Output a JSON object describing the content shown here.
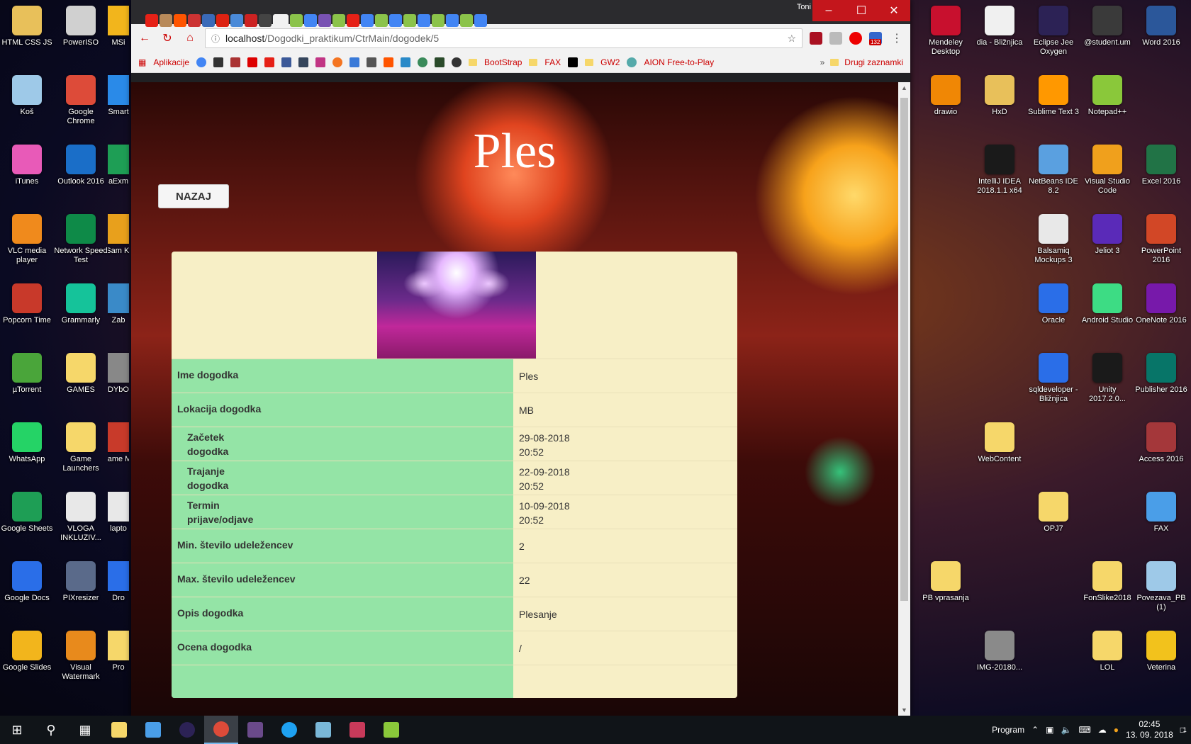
{
  "desktop": {
    "left_icons": [
      {
        "label": "HTML CSS JS",
        "color": "#e8c05a"
      },
      {
        "label": "Koš",
        "color": "#9ec9e8"
      },
      {
        "label": "iTunes",
        "color": "#e85ab8"
      },
      {
        "label": "VLC media player",
        "color": "#f08a1c"
      },
      {
        "label": "Popcorn Time",
        "color": "#c8392a"
      },
      {
        "label": "µTorrent",
        "color": "#4aa53a"
      },
      {
        "label": "WhatsApp",
        "color": "#25d366"
      },
      {
        "label": "Google Sheets",
        "color": "#1e9e55"
      },
      {
        "label": "Google Docs",
        "color": "#2a6ee8"
      },
      {
        "label": "Google Slides",
        "color": "#f2b51c"
      },
      {
        "label": "PowerISO",
        "color": "#d0d0d0"
      },
      {
        "label": "Google Chrome",
        "color": "#dd4b39"
      },
      {
        "label": "Outlook 2016",
        "color": "#1a6ec8"
      },
      {
        "label": "Network Speed Test",
        "color": "#0e8a48"
      },
      {
        "label": "Grammarly",
        "color": "#15c39a"
      },
      {
        "label": "GAMES",
        "color": "#f6d76a"
      },
      {
        "label": "Game Launchers",
        "color": "#f6d76a"
      },
      {
        "label": "VLOGA INKLUZIV...",
        "color": "#e8e8e8"
      },
      {
        "label": "PIXresizer",
        "color": "#5a6a8a"
      },
      {
        "label": "Visual Watermark",
        "color": "#e88a1c"
      },
      {
        "label": "MSi",
        "color": "#f2b51c"
      },
      {
        "label": "Smart",
        "color": "#2a8ae8"
      },
      {
        "label": "aExm",
        "color": "#1e9e55"
      },
      {
        "label": "Sam Ki",
        "color": "#e8a01c"
      },
      {
        "label": "Zab",
        "color": "#3a8ac8"
      },
      {
        "label": "DYbO",
        "color": "#888888"
      },
      {
        "label": "Game My",
        "color": "#c83a2a"
      },
      {
        "label": "lapto",
        "color": "#e8e8e8"
      },
      {
        "label": "Dro",
        "color": "#2a6ee8"
      },
      {
        "label": "Pro",
        "color": "#f6d76a"
      }
    ],
    "right_icons": [
      {
        "label": "Mendeley Desktop",
        "color": "#c8102e"
      },
      {
        "label": "drawio",
        "color": "#f08705"
      },
      {
        "label": "",
        "color": ""
      },
      {
        "label": "",
        "color": ""
      },
      {
        "label": "",
        "color": ""
      },
      {
        "label": "",
        "color": ""
      },
      {
        "label": "",
        "color": ""
      },
      {
        "label": "",
        "color": ""
      },
      {
        "label": "PB vprasanja",
        "color": "#f6d76a"
      },
      {
        "label": "",
        "color": ""
      },
      {
        "label": "dia - Bližnjica",
        "color": "#f0f0f0"
      },
      {
        "label": "HxD",
        "color": "#e8c05a"
      },
      {
        "label": "IntelliJ IDEA 2018.1.1 x64",
        "color": "#1a1a1a"
      },
      {
        "label": "",
        "color": ""
      },
      {
        "label": "",
        "color": ""
      },
      {
        "label": "",
        "color": ""
      },
      {
        "label": "WebContent",
        "color": "#f6d76a"
      },
      {
        "label": "",
        "color": ""
      },
      {
        "label": "",
        "color": ""
      },
      {
        "label": "IMG-20180...",
        "color": "#8a8a8a"
      },
      {
        "label": "Eclipse Jee Oxygen",
        "color": "#2c2255"
      },
      {
        "label": "Sublime Text 3",
        "color": "#ff9800"
      },
      {
        "label": "NetBeans IDE 8.2",
        "color": "#5aa0e0"
      },
      {
        "label": "Balsamiq Mockups 3",
        "color": "#e8e8e8"
      },
      {
        "label": "Oracle",
        "color": "#2a6ee8"
      },
      {
        "label": "sqldeveloper - Bližnjica",
        "color": "#2a6ee8"
      },
      {
        "label": "",
        "color": ""
      },
      {
        "label": "OPJ7",
        "color": "#f6d76a"
      },
      {
        "label": "",
        "color": ""
      },
      {
        "label": "",
        "color": ""
      },
      {
        "label": "@student.um",
        "color": "#3a3a3a"
      },
      {
        "label": "Notepad++",
        "color": "#8ac83a"
      },
      {
        "label": "Visual Studio Code",
        "color": "#f0a01c"
      },
      {
        "label": "Jeliot 3",
        "color": "#5a2ab8"
      },
      {
        "label": "Android Studio",
        "color": "#3ddc84"
      },
      {
        "label": "Unity 2017.2.0...",
        "color": "#1a1a1a"
      },
      {
        "label": "",
        "color": ""
      },
      {
        "label": "",
        "color": ""
      },
      {
        "label": "FonSlike2018",
        "color": "#f6d76a"
      },
      {
        "label": "LOL",
        "color": "#f6d76a"
      },
      {
        "label": "Word 2016",
        "color": "#2b579a"
      },
      {
        "label": "",
        "color": ""
      },
      {
        "label": "Excel 2016",
        "color": "#217346"
      },
      {
        "label": "PowerPoint 2016",
        "color": "#d24726"
      },
      {
        "label": "OneNote 2016",
        "color": "#7719aa"
      },
      {
        "label": "Publisher 2016",
        "color": "#077568"
      },
      {
        "label": "Access 2016",
        "color": "#a4373a"
      },
      {
        "label": "FAX",
        "color": "#4a9ee8"
      },
      {
        "label": "Povezava_PB (1)",
        "color": "#9ec9e8"
      },
      {
        "label": "Veterina",
        "color": "#f2c21c"
      }
    ]
  },
  "browser": {
    "user": "Toni",
    "url_host": "localhost",
    "url_path": "/Dogodki_praktikum/CtrMain/dogodek/5",
    "extension_badge": "132",
    "bookmarks": {
      "apps": "Aplikacije",
      "items": [
        "BootStrap",
        "FAX",
        "GW2",
        "AION Free-to-Play"
      ],
      "more": "»",
      "other": "Drugi zaznamki"
    }
  },
  "page": {
    "title": "Ples",
    "back_label": "NAZAJ",
    "rows": [
      {
        "label": "Ime dogodka",
        "value": "Ples"
      },
      {
        "label": "Lokacija dogodka",
        "value": "MB"
      },
      {
        "label": "Začetek dogodka",
        "value": "29-08-2018 20:52"
      },
      {
        "label": "Trajanje dogodka",
        "value": "22-09-2018 20:52"
      },
      {
        "label": "Termin prijave/odjave",
        "value": "10-09-2018 20:52"
      },
      {
        "label": "Min. število udeležencev",
        "value": "2"
      },
      {
        "label": "Max. število udeležencev",
        "value": "22"
      },
      {
        "label": "Opis dogodka",
        "value": "Plesanje"
      },
      {
        "label": "Ocena dogodka",
        "value": "/"
      }
    ],
    "two_line_rows": {
      "start": {
        "l1": "Začetek",
        "l2": "dogodka",
        "v1": "29-08-2018",
        "v2": "20:52"
      },
      "duration": {
        "l1": "Trajanje",
        "l2": "dogodka",
        "v1": "22-09-2018",
        "v2": "20:52"
      },
      "term": {
        "l1": "Termin",
        "l2": "prijave/odjave",
        "v1": "10-09-2018",
        "v2": "20:52"
      }
    }
  },
  "taskbar": {
    "program_label": "Program",
    "time": "02:45",
    "date": "13. 09. 2018",
    "notifications": "1"
  }
}
